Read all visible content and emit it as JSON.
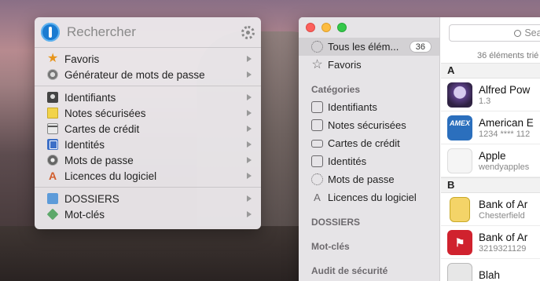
{
  "mini": {
    "search_placeholder": "Rechercher",
    "group1": [
      {
        "label": "Favoris",
        "icon": "star-icon"
      },
      {
        "label": "Générateur de mots de passe",
        "icon": "generator-icon"
      }
    ],
    "group2": [
      {
        "label": "Identifiants",
        "icon": "login-icon"
      },
      {
        "label": "Notes sécurisées",
        "icon": "note-icon"
      },
      {
        "label": "Cartes de crédit",
        "icon": "credit-card-icon"
      },
      {
        "label": "Identités",
        "icon": "identity-icon"
      },
      {
        "label": "Mots de passe",
        "icon": "password-icon"
      },
      {
        "label": "Licences du logiciel",
        "icon": "software-license-icon"
      }
    ],
    "group3": [
      {
        "label": "DOSSIERS",
        "icon": "folder-icon"
      },
      {
        "label": "Mot-clés",
        "icon": "tag-icon"
      }
    ]
  },
  "sidebar": {
    "all_items": {
      "label": "Tous les élém...",
      "count": "36"
    },
    "favorites": "Favoris",
    "categories_header": "Catégories",
    "categories": [
      {
        "label": "Identifiants",
        "icon": "login-icon"
      },
      {
        "label": "Notes sécurisées",
        "icon": "note-icon"
      },
      {
        "label": "Cartes de crédit",
        "icon": "credit-card-icon"
      },
      {
        "label": "Identités",
        "icon": "identity-icon"
      },
      {
        "label": "Mots de passe",
        "icon": "key-icon"
      },
      {
        "label": "Licences du logiciel",
        "icon": "software-license-icon"
      }
    ],
    "folders_header": "DOSSIERS",
    "tags_header": "Mot-clés",
    "audit_header": "Audit de sécurité"
  },
  "list": {
    "search_placeholder": "Searc",
    "count_label": "36 éléments trié",
    "sections": [
      {
        "letter": "A",
        "rows": [
          {
            "title": "Alfred Pow",
            "subtitle": "1.3"
          },
          {
            "title": "American E",
            "subtitle": "1234 **** 112"
          },
          {
            "title": "Apple",
            "subtitle": "wendyapples"
          }
        ]
      },
      {
        "letter": "B",
        "rows": [
          {
            "title": "Bank of Ar",
            "subtitle": "Chesterfield"
          },
          {
            "title": "Bank of Ar",
            "subtitle": "3219321129"
          },
          {
            "title": "Blah",
            "subtitle": ""
          }
        ]
      }
    ],
    "thumbs": {
      "amex": "AMEX",
      "boa": "⚑",
      "apple": ""
    }
  },
  "colors": {
    "accent": "#1a7bd1",
    "selection": "#d3d1d4"
  }
}
